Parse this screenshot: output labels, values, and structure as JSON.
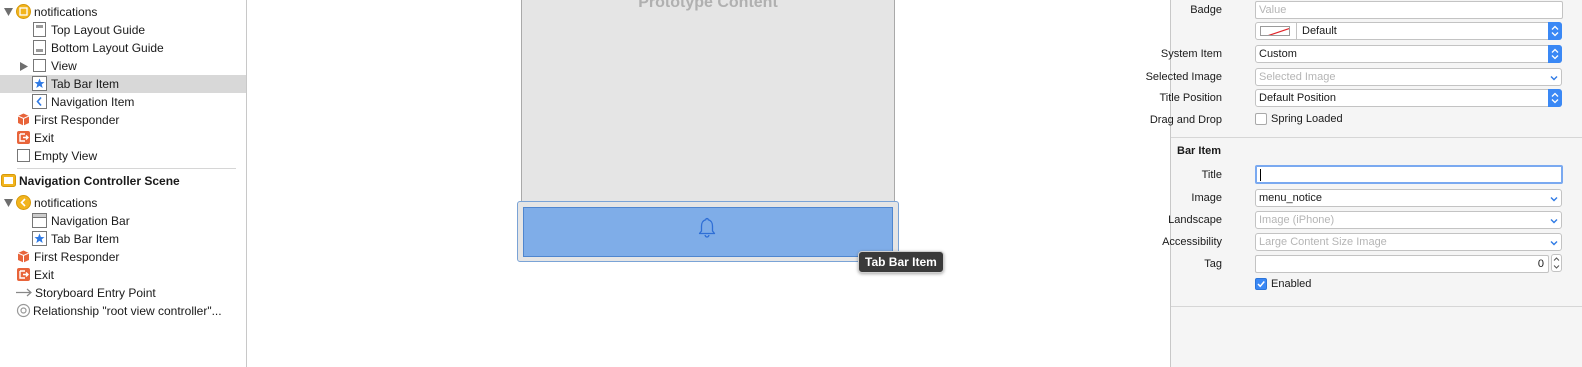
{
  "outline": {
    "items": [
      {
        "label": "notifications",
        "icon": "view-controller-icon"
      },
      {
        "label": "Top Layout Guide",
        "icon": "layout-guide-icon"
      },
      {
        "label": "Bottom Layout Guide",
        "icon": "layout-guide-icon"
      },
      {
        "label": "View",
        "icon": "view-icon"
      },
      {
        "label": "Tab Bar Item",
        "icon": "tab-bar-item-icon"
      },
      {
        "label": "Navigation Item",
        "icon": "navigation-item-icon"
      },
      {
        "label": "First Responder",
        "icon": "first-responder-icon"
      },
      {
        "label": "Exit",
        "icon": "exit-icon"
      },
      {
        "label": "Empty View",
        "icon": "view-icon"
      },
      {
        "label": "Navigation Controller Scene",
        "icon": "scene-icon"
      },
      {
        "label": "notifications",
        "icon": "navigation-controller-icon"
      },
      {
        "label": "Navigation Bar",
        "icon": "navigation-bar-icon"
      },
      {
        "label": "Tab Bar Item",
        "icon": "tab-bar-item-icon"
      },
      {
        "label": "First Responder",
        "icon": "first-responder-icon"
      },
      {
        "label": "Exit",
        "icon": "exit-icon"
      },
      {
        "label": "Storyboard Entry Point",
        "icon": "arrow-icon"
      },
      {
        "label": "Relationship \"root view controller\"...",
        "icon": "relationship-icon"
      }
    ]
  },
  "canvas": {
    "prototype_text": "Prototype Content",
    "tooltip": "Tab Bar Item",
    "tab_icon": "bell-icon"
  },
  "inspector": {
    "badge_label": "Badge",
    "badge_placeholder": "Value",
    "color_value": "Default",
    "system_item_label": "System Item",
    "system_item_value": "Custom",
    "selected_image_label": "Selected Image",
    "selected_image_placeholder": "Selected Image",
    "title_position_label": "Title Position",
    "title_position_value": "Default Position",
    "drag_drop_label": "Drag and Drop",
    "spring_loaded_label": "Spring Loaded",
    "spring_loaded_checked": false,
    "bar_item_header": "Bar Item",
    "title_label": "Title",
    "title_value": "",
    "image_label": "Image",
    "image_value": "menu_notice",
    "landscape_label": "Landscape",
    "landscape_placeholder": "Image (iPhone)",
    "accessibility_label": "Accessibility",
    "accessibility_placeholder": "Large Content Size Image",
    "tag_label": "Tag",
    "tag_value": "0",
    "enabled_label": "Enabled",
    "enabled_checked": true
  },
  "colors": {
    "accent": "#3a88f5",
    "selection": "#d8d8d8",
    "tabbar": "#7fade8",
    "icon_yellow": "#f2b41d",
    "icon_orange": "#e8643a"
  }
}
